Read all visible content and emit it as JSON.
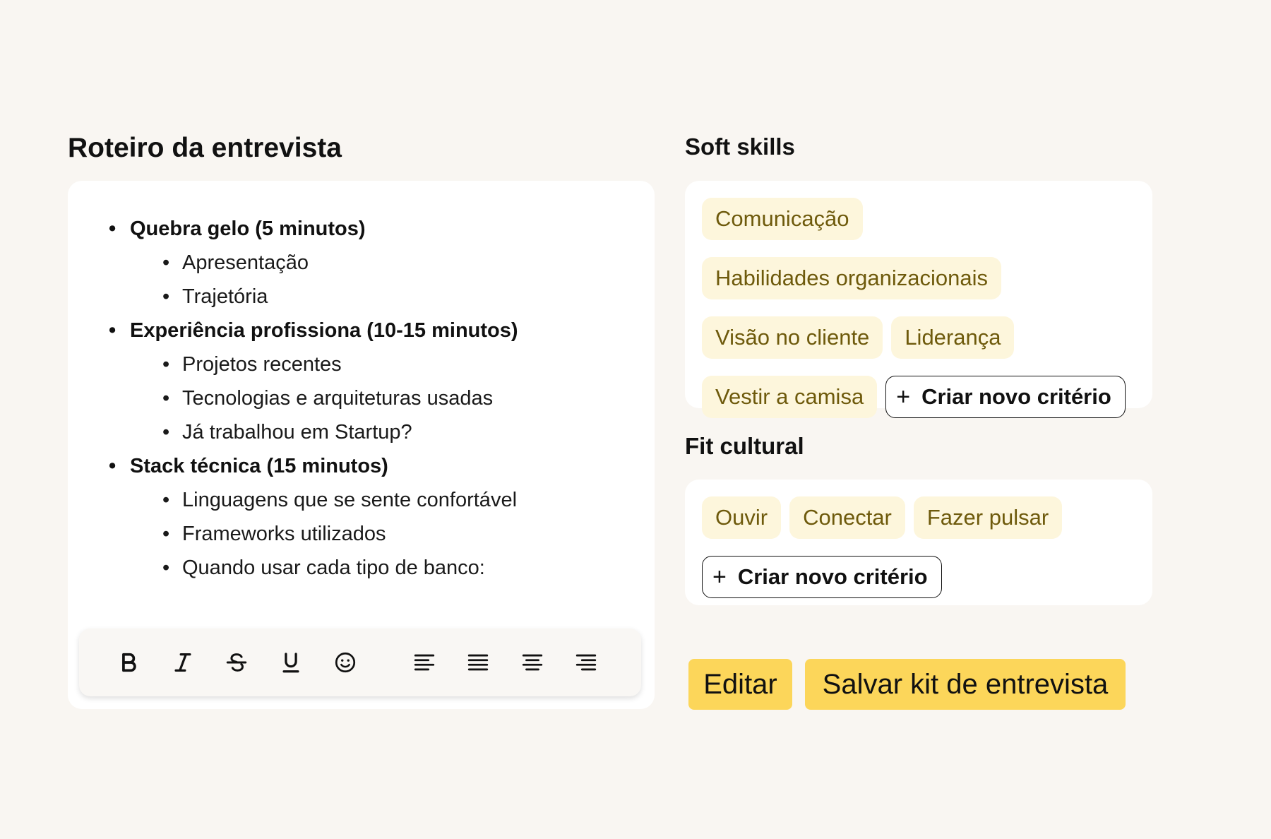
{
  "interview_script": {
    "title": "Roteiro da entrevista",
    "sections": [
      {
        "label": "Quebra gelo (5 minutos)",
        "items": [
          "Apresentação",
          "Trajetória"
        ]
      },
      {
        "label": "Experiência profissiona (10-15 minutos)",
        "items": [
          "Projetos recentes",
          "Tecnologias e arquiteturas usadas",
          "Já trabalhou em Startup?"
        ]
      },
      {
        "label": "Stack técnica (15 minutos)",
        "items": [
          "Linguagens que se sente confortável",
          "Frameworks utilizados",
          "Quando usar cada tipo de banco:"
        ]
      }
    ],
    "toolbar": {
      "tools": [
        "bold-icon",
        "italic-icon",
        "strikethrough-icon",
        "underline-icon",
        "emoji-icon",
        "align-left-icon",
        "align-justify-icon",
        "align-center-icon",
        "align-right-icon"
      ]
    }
  },
  "soft_skills": {
    "title": "Soft skills",
    "chips": [
      "Comunicação",
      "Habilidades organizacionais",
      "Visão no cliente",
      "Liderança",
      "Vestir a camisa"
    ],
    "add_label": "Criar novo critério"
  },
  "fit_cultural": {
    "title": "Fit cultural",
    "chips": [
      "Ouvir",
      "Conectar",
      "Fazer pulsar"
    ],
    "add_label": "Criar novo critério"
  },
  "actions": {
    "edit_label": "Editar",
    "save_label": "Salvar kit de entrevista"
  },
  "colors": {
    "background": "#f9f6f2",
    "card": "#ffffff",
    "chip_bg": "#fdf6dc",
    "chip_text": "#6e5a0c",
    "button_accent": "#fcd65a"
  }
}
